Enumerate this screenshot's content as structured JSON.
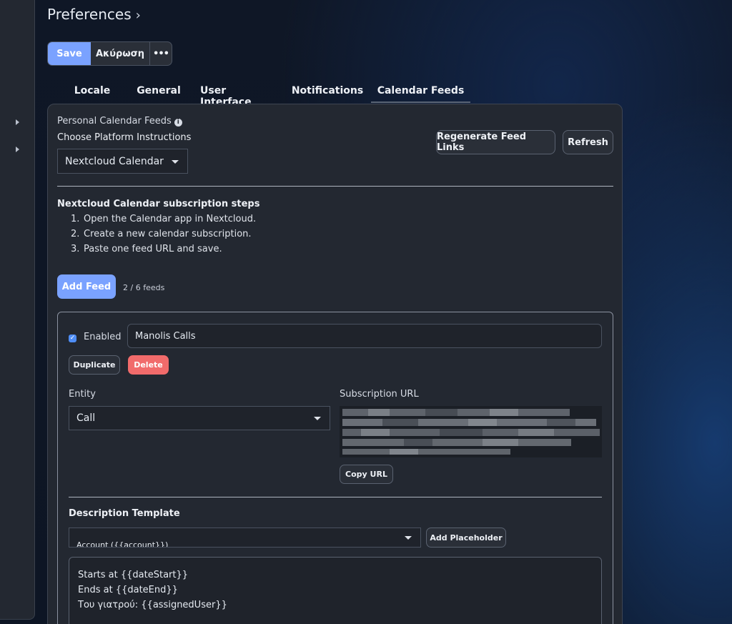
{
  "header": {
    "title": "Preferences",
    "chevron": "›"
  },
  "toolbar": {
    "save_label": "Save",
    "cancel_label": "Ακύρωση",
    "more_label": "•••"
  },
  "tabs": [
    {
      "label": "Locale"
    },
    {
      "label": "General"
    },
    {
      "label": "User Interface"
    },
    {
      "label": "Notifications"
    },
    {
      "label": "Calendar Feeds",
      "active": true
    }
  ],
  "calendar_feeds": {
    "section_label": "Personal Calendar Feeds",
    "info_glyph": "i",
    "platform_label": "Choose Platform Instructions",
    "platform_selected": "Nextcloud Calendar",
    "regenerate_label": "Regenerate Feed Links",
    "refresh_label": "Refresh",
    "steps_title": "Nextcloud Calendar subscription steps",
    "steps": [
      {
        "num": "1.",
        "text": "Open the Calendar app in Nextcloud."
      },
      {
        "num": "2.",
        "text": "Create a new calendar subscription."
      },
      {
        "num": "3.",
        "text": "Paste one feed URL and save."
      }
    ],
    "add_feed_label": "Add Feed",
    "feed_count": "2 / 6 feeds"
  },
  "feed": {
    "enabled_label": "Enabled",
    "enabled": true,
    "name_value": "Manolis Calls",
    "duplicate_label": "Duplicate",
    "delete_label": "Delete",
    "entity_label": "Entity",
    "entity_selected": "Call",
    "subscription_url_label": "Subscription URL",
    "copy_url_label": "Copy URL",
    "description_template_label": "Description Template",
    "placeholder_selected": "Account ({{account}})",
    "add_placeholder_label": "Add Placeholder",
    "template_lines": [
      "Starts at {{dateStart}}",
      "Ends at {{dateEnd}}",
      "Του γιατρού: {{assignedUser}}"
    ]
  },
  "colors": {
    "accent": "#7aa2ff",
    "danger": "#f16b6b",
    "checkbox": "#4f8ef7"
  }
}
